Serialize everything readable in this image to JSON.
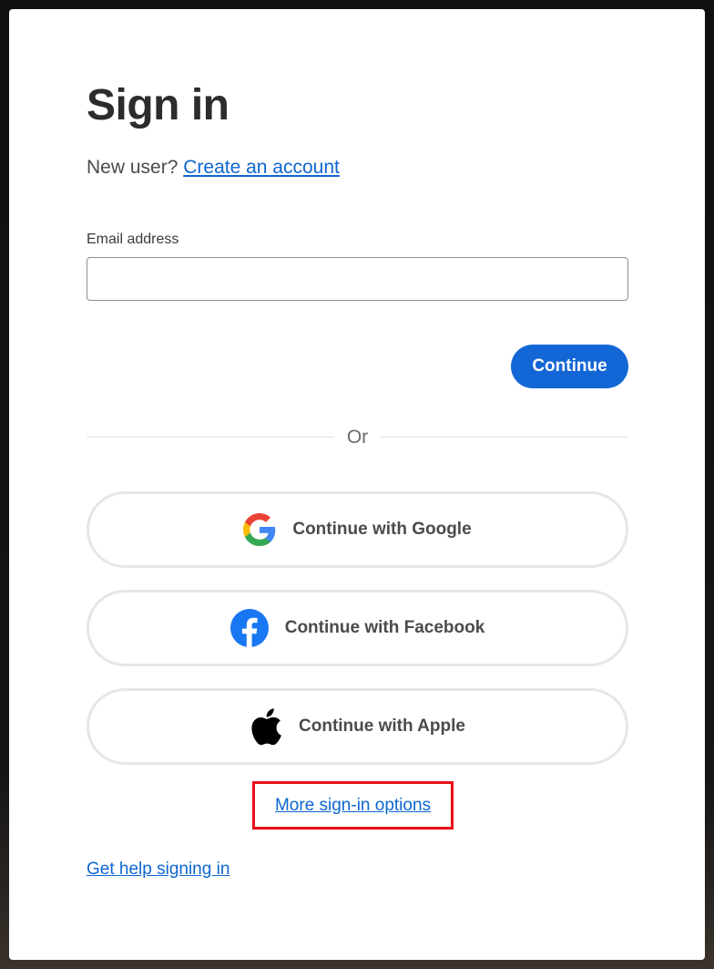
{
  "signin": {
    "title": "Sign in",
    "new_user_prefix": "New user?",
    "create_account_link": "Create an account",
    "email_label": "Email address",
    "email_value": "",
    "email_placeholder": "",
    "continue_label": "Continue",
    "divider_text": "Or",
    "social": {
      "google_label": "Continue with Google",
      "facebook_label": "Continue with Facebook",
      "apple_label": "Continue with Apple"
    },
    "more_options_link": "More sign-in options",
    "help_link": "Get help signing in"
  },
  "colors": {
    "accent": "#1366d6",
    "link": "#0d66d0",
    "highlight_box": "#e8101a",
    "facebook": "#1877f2"
  },
  "icons": [
    "google-icon",
    "facebook-icon",
    "apple-icon"
  ]
}
